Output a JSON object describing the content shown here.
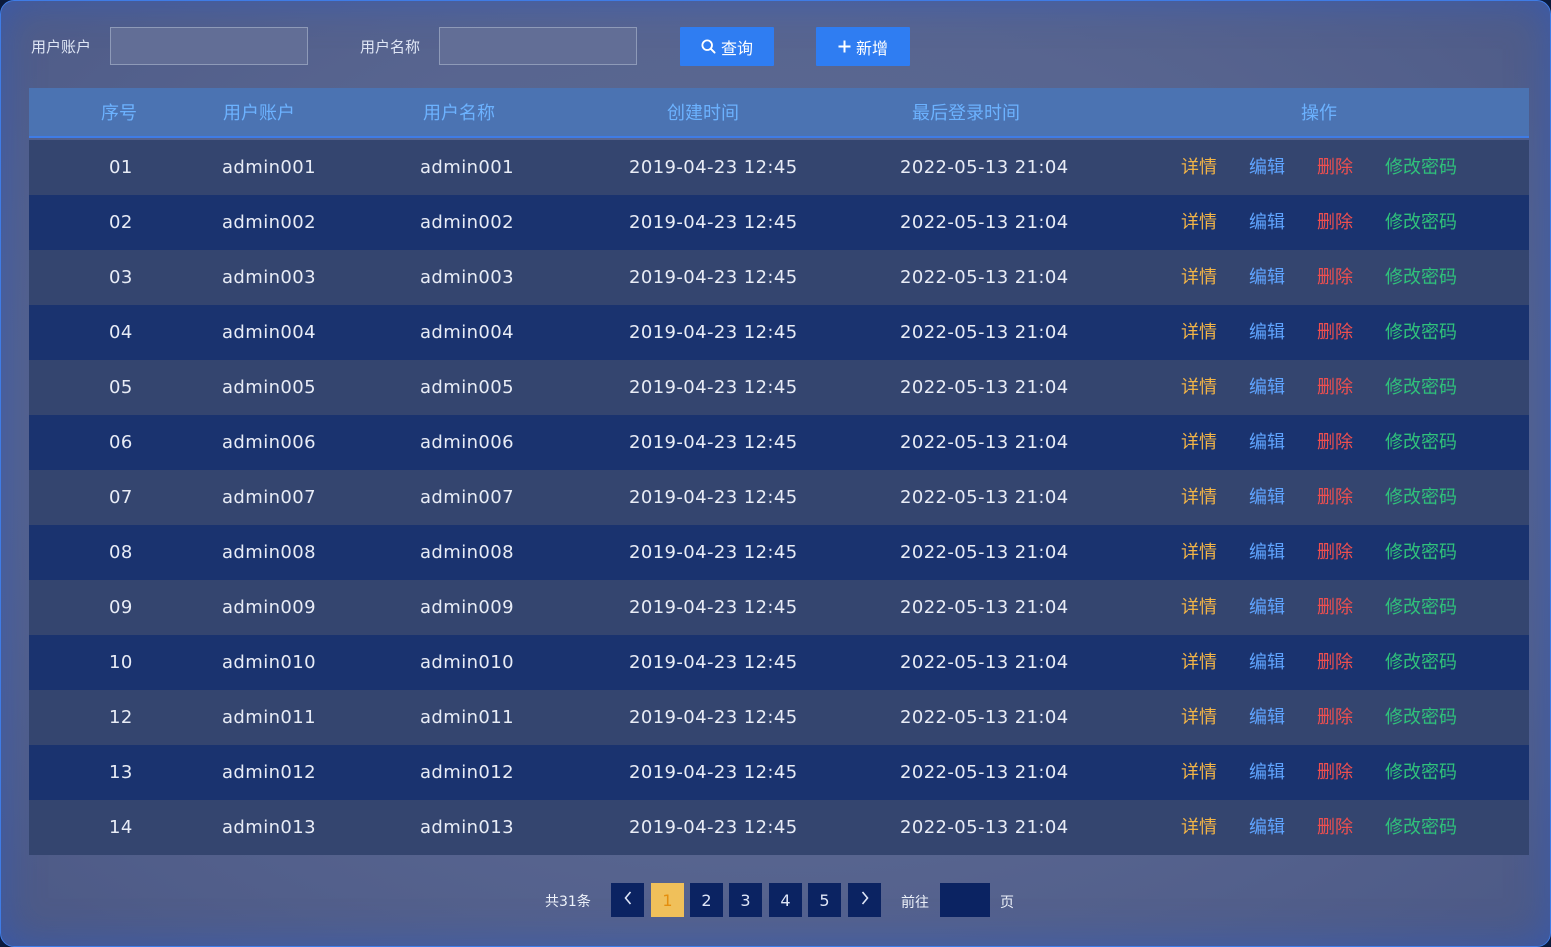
{
  "search": {
    "account_label": "用户账户",
    "account_value": "",
    "name_label": "用户名称",
    "name_value": "",
    "query_button": "查询",
    "add_button": "新增"
  },
  "table": {
    "headers": [
      "序号",
      "用户账户",
      "用户名称",
      "创建时间",
      "最后登录时间",
      "操作"
    ],
    "actions": {
      "detail": "详情",
      "edit": "编辑",
      "delete": "删除",
      "change_password": "修改密码"
    },
    "rows": [
      {
        "no": "01",
        "account": "admin001",
        "name": "admin001",
        "created": "2019-04-23  12:45",
        "last_login": "2022-05-13  21:04"
      },
      {
        "no": "02",
        "account": "admin002",
        "name": "admin002",
        "created": "2019-04-23  12:45",
        "last_login": "2022-05-13  21:04"
      },
      {
        "no": "03",
        "account": "admin003",
        "name": "admin003",
        "created": "2019-04-23  12:45",
        "last_login": "2022-05-13  21:04"
      },
      {
        "no": "04",
        "account": "admin004",
        "name": "admin004",
        "created": "2019-04-23  12:45",
        "last_login": "2022-05-13  21:04"
      },
      {
        "no": "05",
        "account": "admin005",
        "name": "admin005",
        "created": "2019-04-23  12:45",
        "last_login": "2022-05-13  21:04"
      },
      {
        "no": "06",
        "account": "admin006",
        "name": "admin006",
        "created": "2019-04-23  12:45",
        "last_login": "2022-05-13  21:04"
      },
      {
        "no": "07",
        "account": "admin007",
        "name": "admin007",
        "created": "2019-04-23  12:45",
        "last_login": "2022-05-13  21:04"
      },
      {
        "no": "08",
        "account": "admin008",
        "name": "admin008",
        "created": "2019-04-23  12:45",
        "last_login": "2022-05-13  21:04"
      },
      {
        "no": "09",
        "account": "admin009",
        "name": "admin009",
        "created": "2019-04-23  12:45",
        "last_login": "2022-05-13  21:04"
      },
      {
        "no": "10",
        "account": "admin010",
        "name": "admin010",
        "created": "2019-04-23  12:45",
        "last_login": "2022-05-13  21:04"
      },
      {
        "no": "12",
        "account": "admin011",
        "name": "admin011",
        "created": "2019-04-23  12:45",
        "last_login": "2022-05-13  21:04"
      },
      {
        "no": "13",
        "account": "admin012",
        "name": "admin012",
        "created": "2019-04-23  12:45",
        "last_login": "2022-05-13  21:04"
      },
      {
        "no": "14",
        "account": "admin013",
        "name": "admin013",
        "created": "2019-04-23  12:45",
        "last_login": "2022-05-13  21:04"
      }
    ]
  },
  "pagination": {
    "total": "共31条",
    "pages": [
      "1",
      "2",
      "3",
      "4",
      "5"
    ],
    "current": "1",
    "goto_label": "前往",
    "goto_value": "",
    "page_unit": "页"
  },
  "colors": {
    "accent": "#2f7df2",
    "header_text": "#6cb2ff",
    "detail": "#f2b447",
    "edit": "#5fa4ff",
    "delete": "#ef4f4f",
    "change_password": "#2fc27b",
    "active_page": "#f0c05a"
  }
}
